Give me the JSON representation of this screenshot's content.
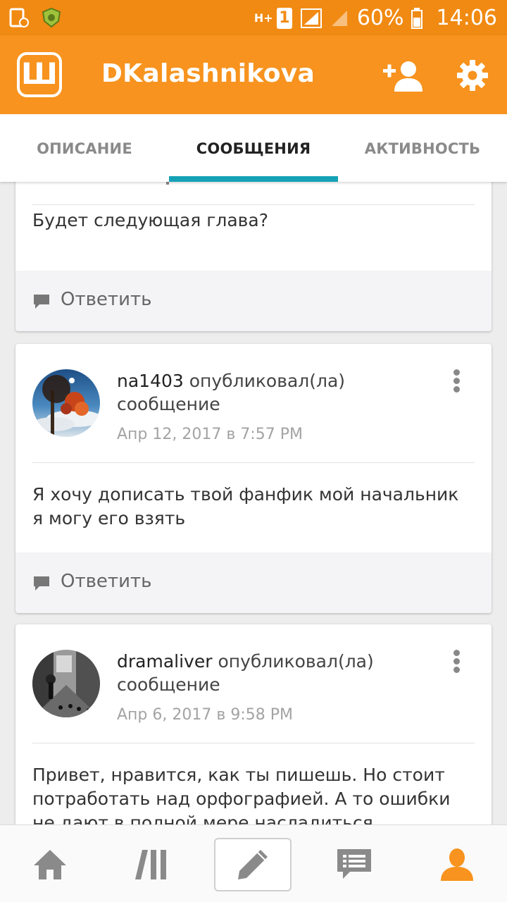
{
  "status_bar": {
    "battery": "60%",
    "time": "14:06",
    "sim_badge": "1",
    "net_label": "H+"
  },
  "header": {
    "title": "DKalashnikova",
    "logo_letter": "Ш"
  },
  "tabs": [
    {
      "label": "ОПИСАНИЕ"
    },
    {
      "label": "СООБЩЕНИЯ"
    },
    {
      "label": "АКТИВНОСТЬ"
    }
  ],
  "posts": [
    {
      "body": "Будет следующая глава?",
      "reply_label": "Ответить"
    },
    {
      "username": "na1403",
      "action": " опубликовал(ла) сообщение",
      "date": "Апр 12, 2017 в 7:57 PM",
      "body": "Я хочу дописать твой фанфик мой начальник я могу его взять",
      "reply_label": "Ответить"
    },
    {
      "username": "dramaliver",
      "action": " опубликовал(ла) сообщение",
      "date": "Апр 6, 2017 в 9:58 PM",
      "body": "Привет, нравится, как ты пишешь. Но стоит потработать над орфографией. А то ошибки не дают в полной мере насладиться"
    }
  ],
  "colors": {
    "status_bar": "#f18a12",
    "app_bar": "#f7931e",
    "tab_indicator": "#16a2b6",
    "profile_active": "#f7931e"
  },
  "icons": {
    "app_logo": "wattpad-logo-icon",
    "add_user": "add-user-icon",
    "settings": "gear-icon",
    "reply": "speech-bubble-icon",
    "more": "vertical-dots-icon",
    "nav": [
      "home-icon",
      "library-icon",
      "write-pencil-icon",
      "messages-icon",
      "profile-icon"
    ]
  }
}
